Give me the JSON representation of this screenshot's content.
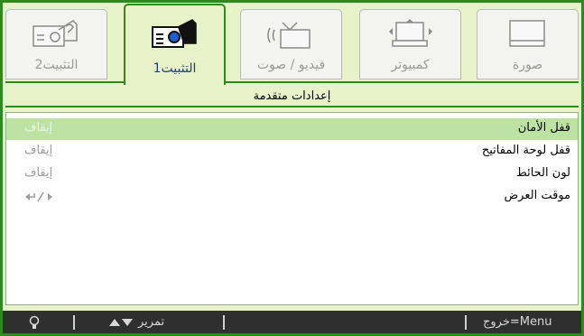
{
  "tabs": [
    {
      "label": "التثبيت2",
      "icon": "projector-setup2-icon"
    },
    {
      "label": "التثبيت1",
      "icon": "projector-setup1-icon"
    },
    {
      "label": "فيديو / صوت",
      "icon": "video-audio-icon"
    },
    {
      "label": "كمبيوتر",
      "icon": "computer-icon"
    },
    {
      "label": "صورة",
      "icon": "image-icon"
    }
  ],
  "active_tab": 1,
  "section_title": "إعدادات متقدمة",
  "rows": [
    {
      "name": "قفل الأمان",
      "value": "إيقاف"
    },
    {
      "name": "قفل لوحة المفاتيح",
      "value": "إيقاف"
    },
    {
      "name": "لون الحائط",
      "value": "إيقاف"
    },
    {
      "name": "موقت العرض",
      "value": ""
    }
  ],
  "footer": {
    "scroll_label": "تمرير",
    "exit_label": "خروج=Menu"
  },
  "colors": {
    "accent": "#2e8a1e",
    "selected_row": "#bde3a4",
    "panel": "#e8f2c8",
    "footer": "#2f2f2f"
  }
}
